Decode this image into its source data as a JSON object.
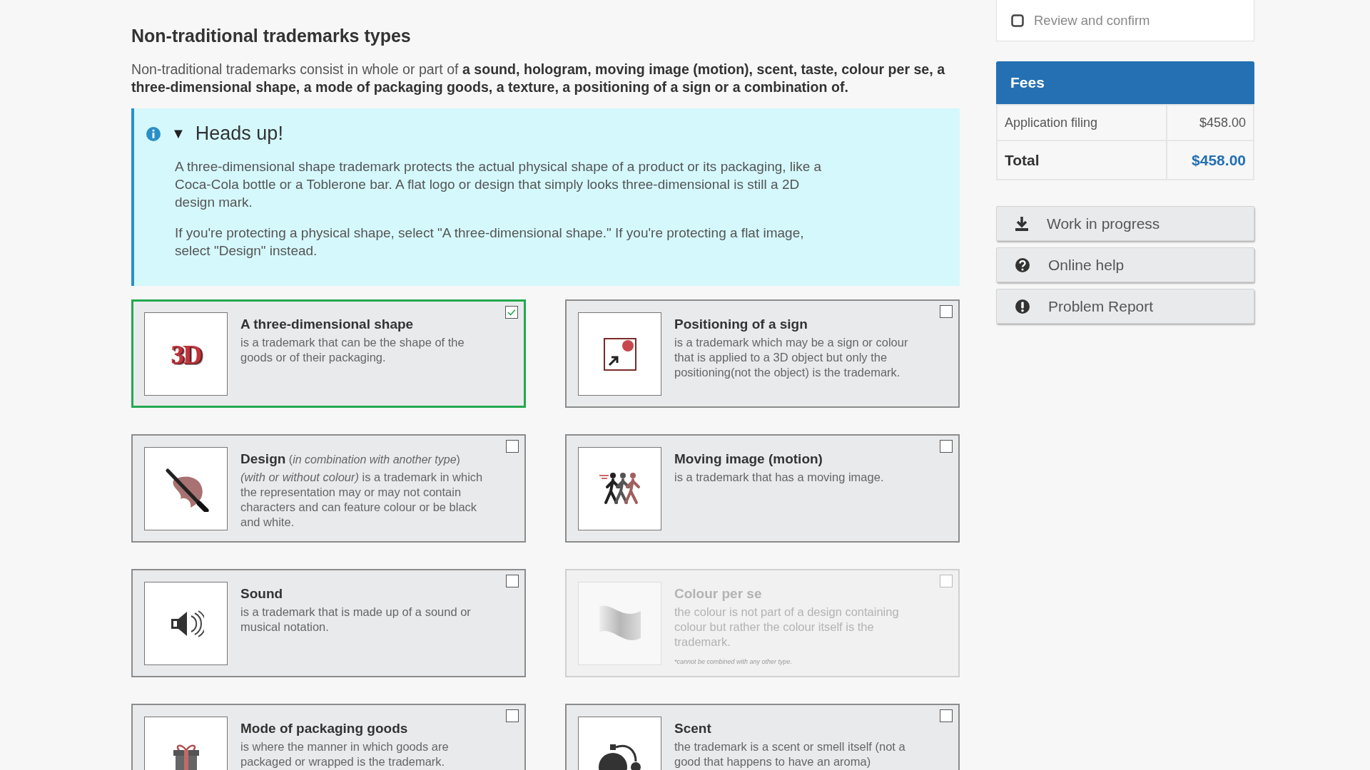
{
  "main": {
    "heading": "Non-traditional trademarks types",
    "intro": "Non-traditional trademarks consist in whole or part of **a sound, hologram, moving image (motion), scent, taste, colour per se, a three-dimensional shape, a mode of packaging goods, a texture, a positioning of a sign or a combination of.**"
  },
  "notice": {
    "toggle": "▼",
    "title": "Heads up!",
    "expanded": true,
    "paragraphs": [
      "A three-dimensional shape trademark protects the actual physical shape of a product or its packaging, like a Coca-Cola bottle or a Toblerone bar. A flat logo or design that simply looks three-dimensional is still a 2D design mark.",
      "If you're protecting a physical shape, select \"A three-dimensional shape.\" If you're protecting a flat image, select \"Design\" instead."
    ]
  },
  "cards": [
    {
      "title": "A three-dimensional shape",
      "icon_text": "3D",
      "description": "is a trademark that can be the shape of the goods or of their packaging.",
      "selected": true,
      "disabled": false
    },
    {
      "title": "Positioning of a sign",
      "description": "is a trademark which may be a sign or colour that is applied to a 3D object but only the positioning(not the object) is the trademark.",
      "selected": false,
      "disabled": false
    },
    {
      "title": "Design",
      "title_note": "(*in combination with another type*)",
      "description": "*(with or without colour)* is a trademark in which the representation may or may not contain characters and can feature colour or be black and white.",
      "selected": false,
      "disabled": false
    },
    {
      "title": "Moving image (motion)",
      "description": "is a trademark that has a moving image.",
      "selected": false,
      "disabled": false
    },
    {
      "title": "Sound",
      "description": "is a trademark that is made up of a sound or musical notation.",
      "selected": false,
      "disabled": false
    },
    {
      "title": "Colour per se",
      "description": "the colour is not part of a design containing colour but rather the colour itself is the trademark.",
      "footnote": "*cannot be combined with any other type.",
      "selected": false,
      "disabled": true
    },
    {
      "title": "Mode of packaging goods",
      "description": "is where the manner in which goods are packaged or wrapped is the trademark.",
      "selected": false,
      "disabled": false
    },
    {
      "title": "Scent",
      "description": "the trademark is a scent or smell itself (not a good that happens to have an aroma)",
      "selected": false,
      "disabled": false
    }
  ],
  "sidebar": {
    "steps": [
      {
        "label": "Review and confirm",
        "checked": false
      }
    ],
    "fees": {
      "title": "Fees",
      "rows": [
        {
          "kind": "item",
          "label": "Application filing",
          "amount": "$458.00"
        },
        {
          "kind": "total",
          "label": "Total",
          "amount": "$458.00"
        }
      ]
    },
    "buttons": [
      {
        "label": "Work in progress"
      },
      {
        "label": "Online help"
      },
      {
        "label": "Problem Report"
      }
    ]
  }
}
